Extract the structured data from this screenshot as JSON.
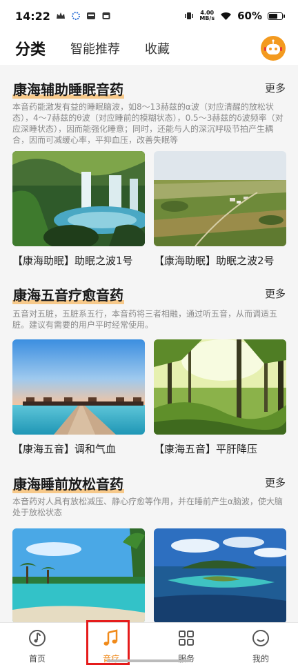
{
  "status_bar": {
    "time": "14:22",
    "speed_value": "4.00",
    "speed_unit": "MB/s",
    "battery_text": "60%",
    "battery_level": 0.6
  },
  "header": {
    "tabs": [
      {
        "label": "分类",
        "active": true
      },
      {
        "label": "智能推荐",
        "active": false
      },
      {
        "label": "收藏",
        "active": false
      }
    ]
  },
  "sections": [
    {
      "title": "康海辅助睡眠音药",
      "more": "更多",
      "description": "本音药能激发有益的睡眠脑波，如8～13赫兹的α波（对应清醒的放松状态），4～7赫兹的θ波（对应睡前的模糊状态），0.5～3赫兹的δ波频率（对应深睡状态），因而能强化睡意；同时，还能与人的深沉呼吸节拍产生耦合，因而可减缓心率，平抑血压，改善失眠等",
      "cards": [
        {
          "caption": "【康海助眠】助眠之波1号",
          "image": "waterfall"
        },
        {
          "caption": "【康海助眠】助眠之波2号",
          "image": "farmland"
        }
      ]
    },
    {
      "title": "康海五音疗愈音药",
      "more": "更多",
      "description": "五音对五脏，五脏系五行，本音药将三者相融，通过听五音，从而调适五脏。建议有需要的用户平时经常使用。",
      "cards": [
        {
          "caption": "【康海五音】调和气血",
          "image": "pier-sunset"
        },
        {
          "caption": "【康海五音】平肝降压",
          "image": "forest"
        }
      ]
    },
    {
      "title": "康海睡前放松音药",
      "more": "更多",
      "description": "本音药对人具有放松减压、静心疗愈等作用，并在睡前产生α脑波，使大脑处于放松状态",
      "cards": [
        {
          "caption": "",
          "image": "palm-beach"
        },
        {
          "caption": "",
          "image": "island"
        }
      ]
    }
  ],
  "bottom_nav": [
    {
      "label": "首页",
      "icon": "music-note-circle-icon",
      "active": false
    },
    {
      "label": "音疗",
      "icon": "music-note-icon",
      "active": true
    },
    {
      "label": "服务",
      "icon": "grid-icon",
      "active": false
    },
    {
      "label": "我的",
      "icon": "smiley-icon",
      "active": false
    }
  ],
  "colors": {
    "accent": "#f39a1f",
    "highlight": "#e51b1b"
  }
}
